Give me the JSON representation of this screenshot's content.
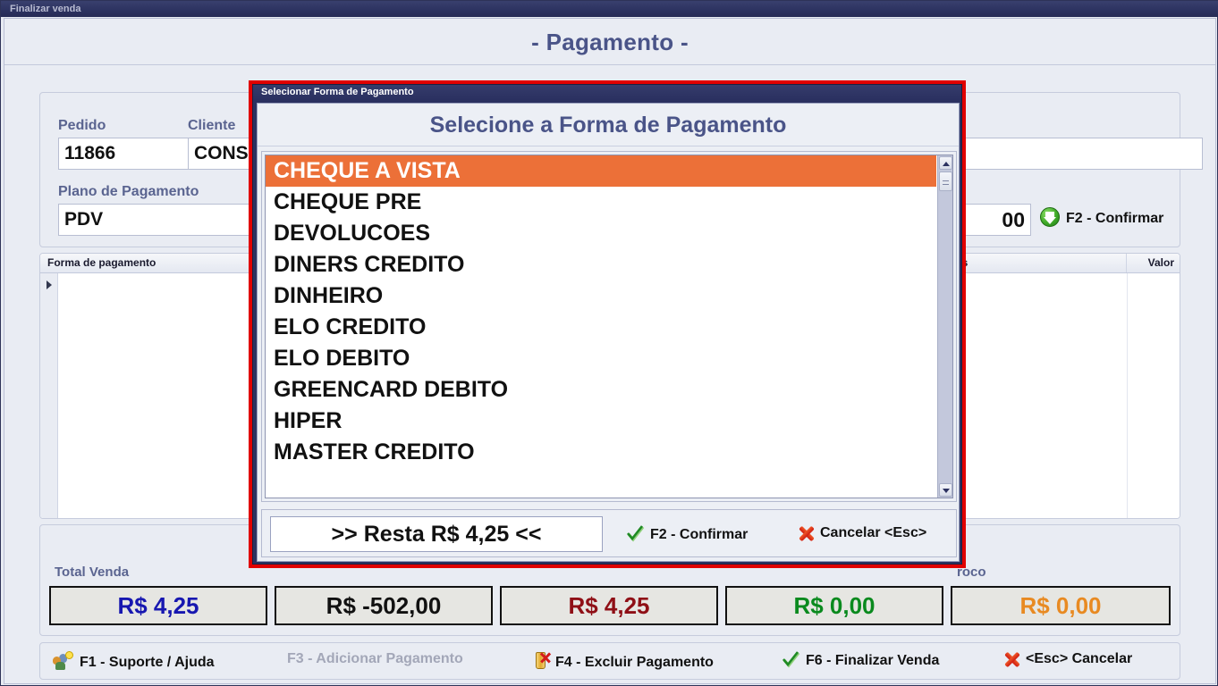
{
  "window": {
    "caption": "Finalizar venda"
  },
  "page": {
    "title": "- Pagamento -"
  },
  "form": {
    "pedido_label": "Pedido",
    "pedido_value": "11866",
    "cliente_label": "Cliente",
    "cliente_value": "CONSUMIDOR FINAL",
    "cliente_extra_value": "",
    "plano_label": "Plano de Pagamento",
    "plano_value": "PDV",
    "valor_value": "00",
    "confirm_label": "F2 - Confirmar",
    "confirm_icon": "green-down-arrow-icon"
  },
  "grid": {
    "columns": [
      {
        "label": "Forma de pagamento"
      },
      {
        "label": "as"
      },
      {
        "label": "Valor"
      }
    ],
    "rows": []
  },
  "summary": {
    "items": [
      {
        "label": "Total Venda",
        "value": "R$ 4,25",
        "color": "#1717b0"
      },
      {
        "label": "",
        "value": "R$ -502,00",
        "color": "#111111"
      },
      {
        "label": "",
        "value": "R$ 4,25",
        "color": "#8f0f16"
      },
      {
        "label": "",
        "value": "R$ 0,00",
        "color": "#0a8a1e"
      },
      {
        "label": "roco",
        "value": "R$ 0,00",
        "color": "#e88a22"
      }
    ]
  },
  "fnbar": {
    "items": [
      {
        "label": "F1 - Suporte / Ajuda",
        "icon": "support-icon",
        "disabled": false
      },
      {
        "label": "F3 - Adicionar Pagamento",
        "icon": "none",
        "disabled": true
      },
      {
        "label": "F4 - Excluir Pagamento",
        "icon": "delete-icon",
        "disabled": false
      },
      {
        "label": "F6 - Finalizar Venda",
        "icon": "check-icon",
        "disabled": false
      },
      {
        "label": "<Esc> Cancelar",
        "icon": "x-icon",
        "disabled": false
      }
    ]
  },
  "modal": {
    "caption": "Selecionar Forma de Pagamento",
    "heading": "Selecione a Forma de Pagamento",
    "border_color": "#e00000",
    "selected_color": "#ec7038",
    "options": [
      "CHEQUE A VISTA",
      "CHEQUE PRE",
      "DEVOLUCOES",
      "DINERS CREDITO",
      "DINHEIRO",
      "ELO CREDITO",
      "ELO DEBITO",
      "GREENCARD DEBITO",
      "HIPER",
      "MASTER CREDITO"
    ],
    "selected_index": 0,
    "footer": {
      "resta_label": ">> Resta R$ 4,25 <<",
      "confirm_label": "F2 - Confirmar",
      "cancel_label": "Cancelar <Esc>"
    }
  }
}
